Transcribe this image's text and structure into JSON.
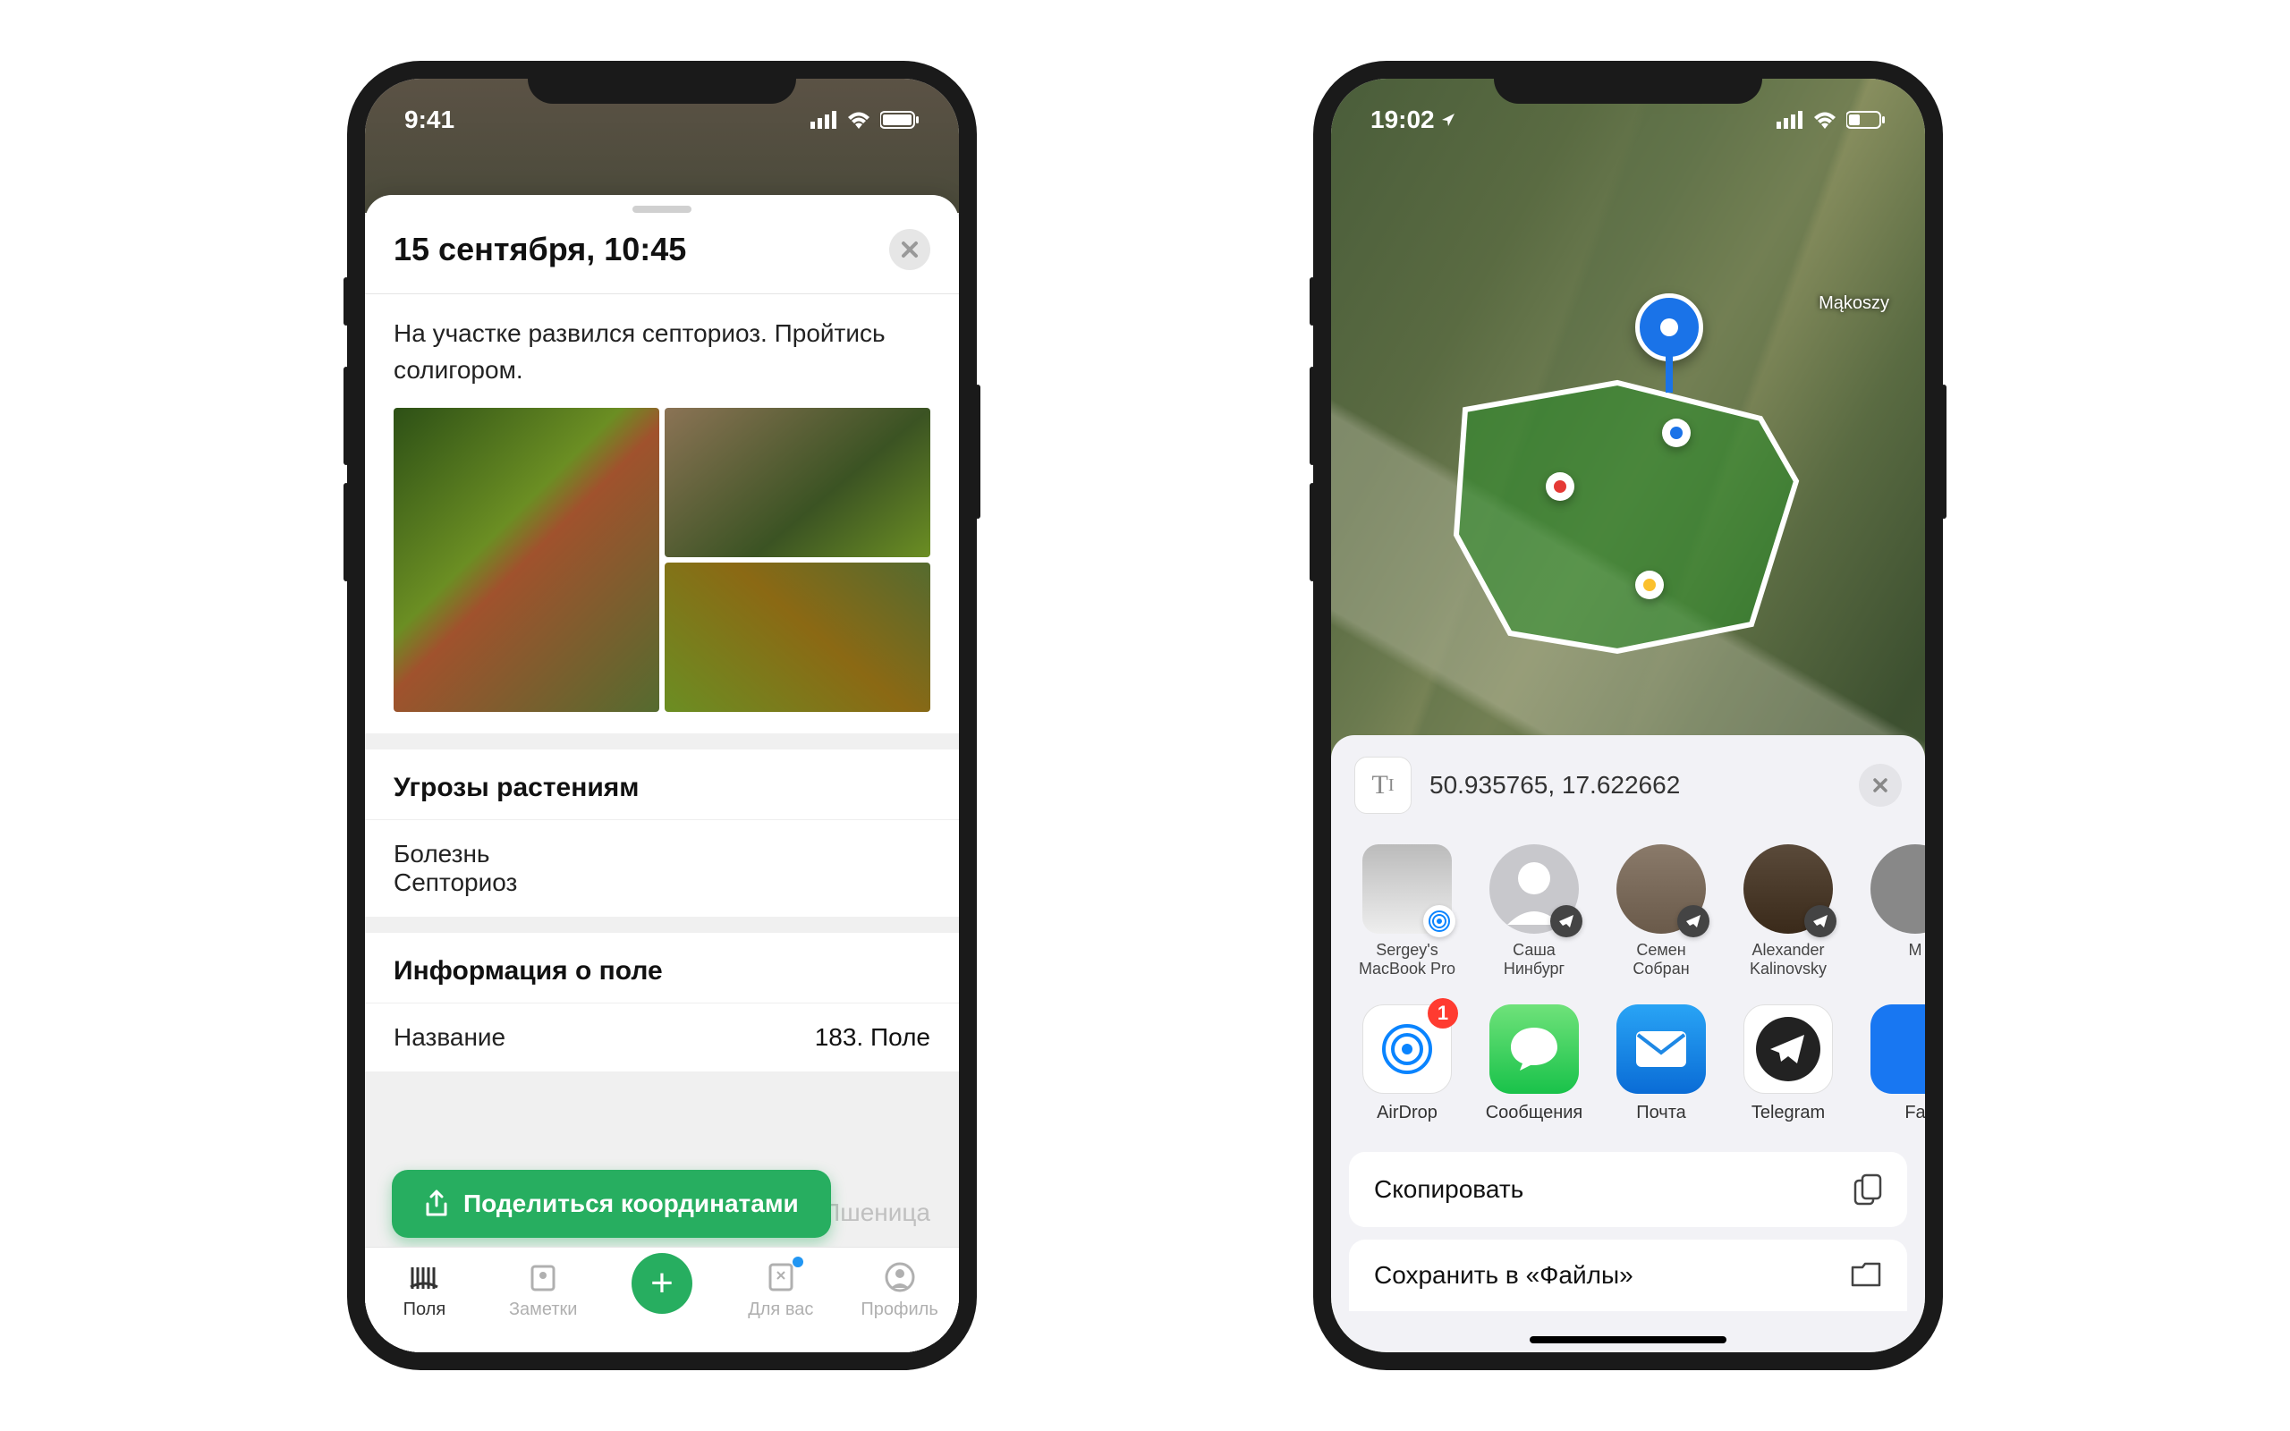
{
  "phone1": {
    "status_time": "9:41",
    "card_title": "15 сентября, 10:45",
    "note_body": "На участке развился септориоз. Пройтись солигором.",
    "threats_heading": "Угрозы растениям",
    "threat_type": "Болезнь",
    "threat_name": "Септориоз",
    "field_info_heading": "Информация о поле",
    "field_name_label": "Название",
    "field_name_value": "183. Поле",
    "crop_value": "Пшеница",
    "share_button": "Поделиться координатами",
    "tabs": {
      "fields": "Поля",
      "notes": "Заметки",
      "foryou": "Для вас",
      "profile": "Профиль"
    }
  },
  "phone2": {
    "status_time": "19:02",
    "map_place": "Mąkoszy",
    "coords": "50.935765, 17.622662",
    "contacts": [
      {
        "name": "Sergey's MacBook Pro"
      },
      {
        "name": "Саша Нинбург"
      },
      {
        "name": "Семен Собран"
      },
      {
        "name": "Alexander Kalinovsky"
      },
      {
        "name": "M"
      }
    ],
    "apps": {
      "airdrop": "AirDrop",
      "airdrop_badge": "1",
      "messages": "Сообщения",
      "mail": "Почта",
      "telegram": "Telegram",
      "facebook": "Fa"
    },
    "actions": {
      "copy": "Скопировать",
      "save_files": "Сохранить в «Файлы»"
    }
  }
}
